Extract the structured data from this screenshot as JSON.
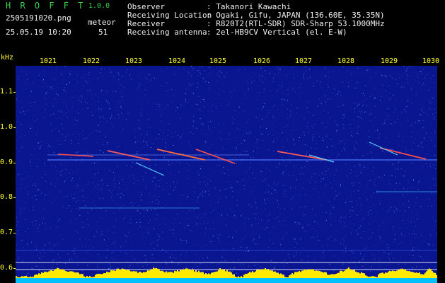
{
  "header": {
    "app_title": "H R O F F T",
    "app_version": "1.0.0",
    "filename": "2505191020.png",
    "meteor_label": "meteor",
    "datetime": "25.05.19 10:20",
    "meteor_count": "51",
    "info": [
      {
        "label": "Observer",
        "value": ": Takanori Kawachi"
      },
      {
        "label": "Receiving Location",
        "value": ": Ogaki, Gifu, JAPAN (136.60E, 35.35N)"
      },
      {
        "label": "Receiver",
        "value": ": R820T2(RTL-SDR) SDR-Sharp 53.1000MHz"
      },
      {
        "label": "Receiving antenna",
        "value": ": 2el-HB9CV Vertical (el. E-W)"
      }
    ]
  },
  "axis": {
    "unit": "kHz",
    "minutes": [
      "1021",
      "1022",
      "1023",
      "1024",
      "1025",
      "1026",
      "1027",
      "1028",
      "1029",
      "1030"
    ],
    "khz": [
      "1.1",
      "1.0",
      "0.9",
      "0.8",
      "0.7",
      "0.6"
    ]
  },
  "colors": {
    "background": "#0a1690",
    "noise": "#2f57ff",
    "echo": "#ff4d4d",
    "level": "#ffea00",
    "baseline": "#00bfff"
  }
}
